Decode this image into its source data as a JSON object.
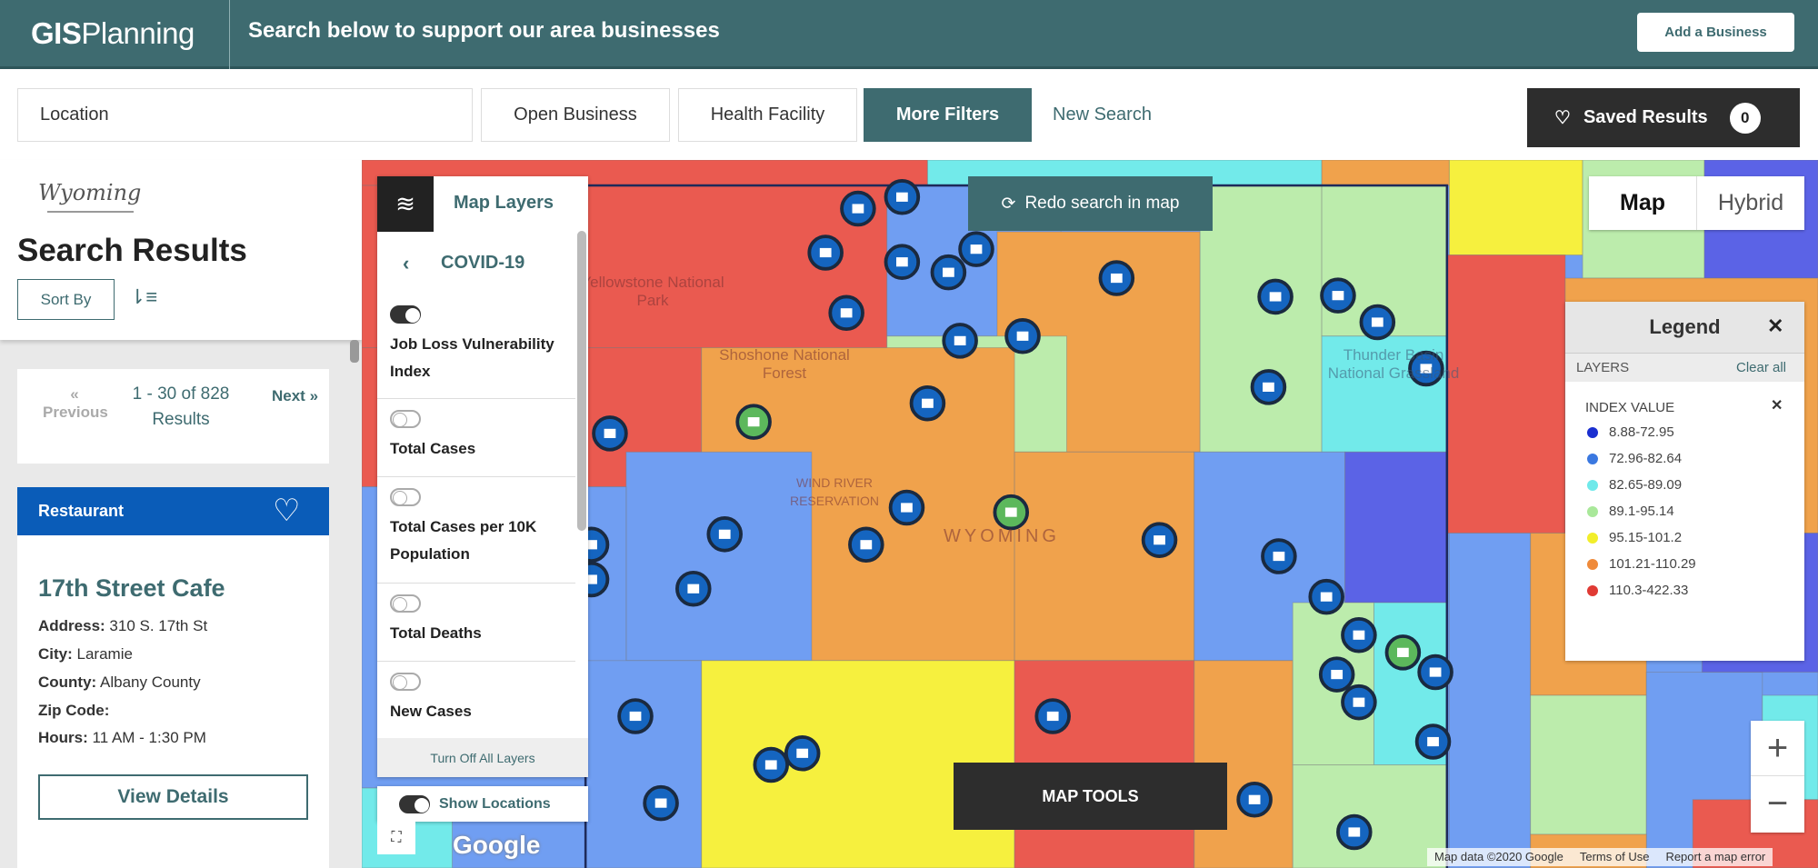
{
  "header": {
    "logo_bold": "GIS",
    "logo_rest": "Planning",
    "tagline": "Search below to support our area businesses",
    "add_business": "Add a Business"
  },
  "filters": {
    "location_placeholder": "Location",
    "open_business": "Open Business",
    "health_facility": "Health Facility",
    "more_filters": "More Filters",
    "new_search": "New Search",
    "saved_results": "Saved Results",
    "saved_count": "0"
  },
  "sidebar": {
    "brand": "Wyoming",
    "title": "Search Results",
    "sort_by": "Sort By",
    "pager": {
      "previous": "Previous",
      "range": "1 - 30 of 828 Results",
      "next": "Next"
    },
    "result": {
      "category": "Restaurant",
      "name": "17th Street Cafe",
      "fields": [
        {
          "label": "Address:",
          "value": "310 S. 17th St"
        },
        {
          "label": "City:",
          "value": "Laramie"
        },
        {
          "label": "County:",
          "value": "Albany County"
        },
        {
          "label": "Zip Code:",
          "value": ""
        },
        {
          "label": "Hours:",
          "value": "11 AM - 1:30 PM"
        }
      ],
      "view_details": "View Details"
    }
  },
  "map_layers": {
    "title": "Map Layers",
    "group": "COVID-19",
    "items": [
      {
        "label": "Job Loss Vulnerability Index",
        "on": true
      },
      {
        "label": "Total Cases",
        "on": false
      },
      {
        "label": "Total Cases per 10K Population",
        "on": false
      },
      {
        "label": "Total Deaths",
        "on": false
      },
      {
        "label": "New Cases",
        "on": false
      }
    ],
    "turn_off_all": "Turn Off All Layers",
    "show_locations": "Show Locations",
    "show_locations_on": true
  },
  "map": {
    "redo_search": "Redo search in map",
    "type_map": "Map",
    "type_hybrid": "Hybrid",
    "selected_type": "Map",
    "map_tools": "MAP TOOLS",
    "google": "Google",
    "attribution": [
      "Map data ©2020 Google",
      "Terms of Use",
      "Report a map error"
    ],
    "labels": {
      "yellowstone": "Yellowstone National Park",
      "shoshone": "Shoshone National Forest",
      "wind_river": "WIND RIVER RESERVATION",
      "state": "WYOMING",
      "thunder": "Thunder Basin National Grassland"
    },
    "colors": {
      "red": "#ea5a50",
      "orange": "#f0a24c",
      "yellow": "#f6f03e",
      "lightgreen": "#bcecac",
      "cyan": "#72eaea",
      "blue": "#709ef2",
      "darkblue": "#5b63e6",
      "marker": "#1565c0"
    }
  },
  "legend": {
    "title": "Legend",
    "layers_label": "LAYERS",
    "clear_all": "Clear all",
    "index_label": "INDEX VALUE",
    "entries": [
      {
        "range": "8.88-72.95",
        "color": "#1a2fd0"
      },
      {
        "range": "72.96-82.64",
        "color": "#3a78e0"
      },
      {
        "range": "82.65-89.09",
        "color": "#6fe9ea"
      },
      {
        "range": "89.1-95.14",
        "color": "#a9e89a"
      },
      {
        "range": "95.15-101.2",
        "color": "#f2ee2a"
      },
      {
        "range": "101.21-110.29",
        "color": "#ef8a3a"
      },
      {
        "range": "110.3-422.33",
        "color": "#e03a34"
      }
    ]
  }
}
